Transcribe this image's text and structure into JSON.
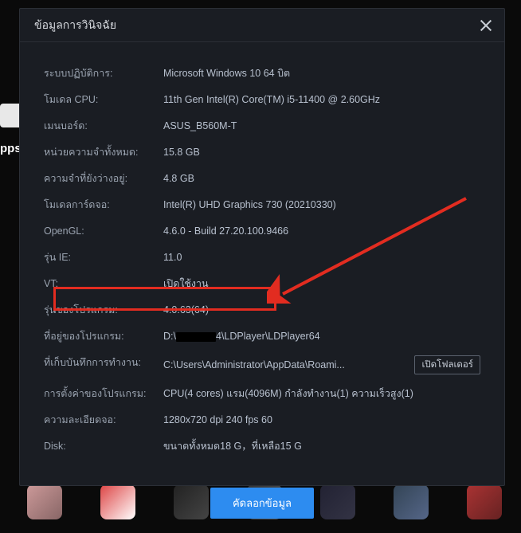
{
  "dialog": {
    "title": "ข้อมูลการวินิจฉัย",
    "rows": {
      "os": {
        "label": "ระบบปฏิบัติการ:",
        "value": "Microsoft Windows 10 64 บิต"
      },
      "cpu": {
        "label": "โมเดล CPU:",
        "value": "11th Gen Intel(R) Core(TM) i5-11400 @ 2.60GHz"
      },
      "mainboard": {
        "label": "เมนบอร์ด:",
        "value": "ASUS_B560M-T"
      },
      "totalmem": {
        "label": "หน่วยความจำทั้งหมด:",
        "value": "15.8 GB"
      },
      "availmem": {
        "label": "ความจำที่ยังว่างอยู่:",
        "value": "4.8 GB"
      },
      "gpu": {
        "label": "โมเดลการ์ดจอ:",
        "value": "Intel(R) UHD Graphics 730 (20210330)"
      },
      "opengl": {
        "label": "OpenGL:",
        "value": "4.6.0 - Build 27.20.100.9466"
      },
      "ie": {
        "label": "รุ่น IE:",
        "value": "11.0"
      },
      "vt": {
        "label": "VT:",
        "value": "เปิดใช้งาน"
      },
      "version": {
        "label": "รุ่นของโปรแกรม:",
        "value": "4.0.63(64)"
      },
      "installdir": {
        "label": "ที่อยู่ของโปรแกรม:",
        "prefix": "D:\\",
        "suffix": "4\\LDPlayer\\LDPlayer64"
      },
      "workdir": {
        "label": "ที่เก็บบันทึกการทำงาน:",
        "value": "C:\\Users\\Administrator\\AppData\\Roami..."
      },
      "settings": {
        "label": "การตั้งค่าของโปรแกรม:",
        "value": "CPU(4 cores) แรม(4096M) กำลังทำงาน(1) ความเร็วสูง(1)"
      },
      "resolution": {
        "label": "ความละเอียดจอ:",
        "value": "1280x720 dpi 240 fps 60"
      },
      "disk": {
        "label": "Disk:",
        "value": "ขนาดทั้งหมด18 G，ที่เหลือ15 G"
      }
    },
    "open_folder_button": "เปิดโฟลเดอร์",
    "copy_button": "คัดลอกข้อมูล"
  },
  "background": {
    "apps_label": "pps"
  }
}
